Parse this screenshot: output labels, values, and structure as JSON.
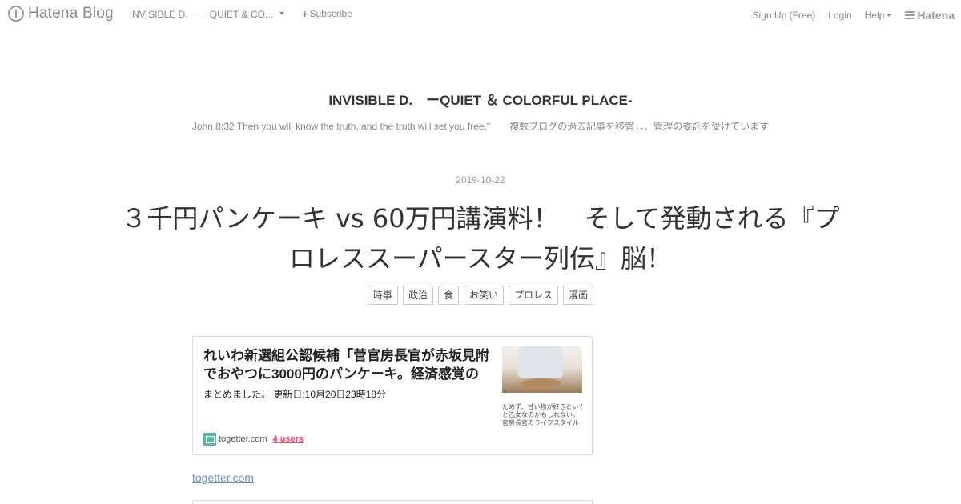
{
  "global_header": {
    "logo_text": "Hatena Blog",
    "blog_name": "INVISIBLE D.　ー QUIET & CO...",
    "subscribe_label": "Subscribe",
    "signup_label": "Sign Up (Free)",
    "login_label": "Login",
    "help_label": "Help",
    "hatena_label": "Hatena"
  },
  "blog": {
    "title": "INVISIBLE D.　ーQUIET ＆ COLORFUL PLACE-",
    "description": "John 8:32 Then you will know the truth, and the truth will set you free.\"　　複数ブログの過去記事を移管し、管理の委託を受けています"
  },
  "entry": {
    "date": "2019-10-22",
    "title_line1": "３千円パンケーキ vs 60万円講演料！　そして発動される『プ",
    "title_line2": "ロレススーパースター列伝』脳！",
    "categories": [
      "時事",
      "政治",
      "食",
      "お笑い",
      "プロレス",
      "漫画"
    ]
  },
  "embed_card": {
    "title": "れいわ新選組公認候補「菅官房長官が赤坂見附でおやつに3000円のパンケーキ。経済感覚のほ",
    "description": "まとめました。 更新日:10月20日23時18分",
    "thumb_text_1": "ためず、甘い物が好きという",
    "thumb_text_2": "と乙女なのかもしれない。",
    "thumb_text_3": "官房長官のライフスタイル",
    "site": "togetter.com",
    "users": "4 users"
  },
  "source_link": "togetter.com"
}
